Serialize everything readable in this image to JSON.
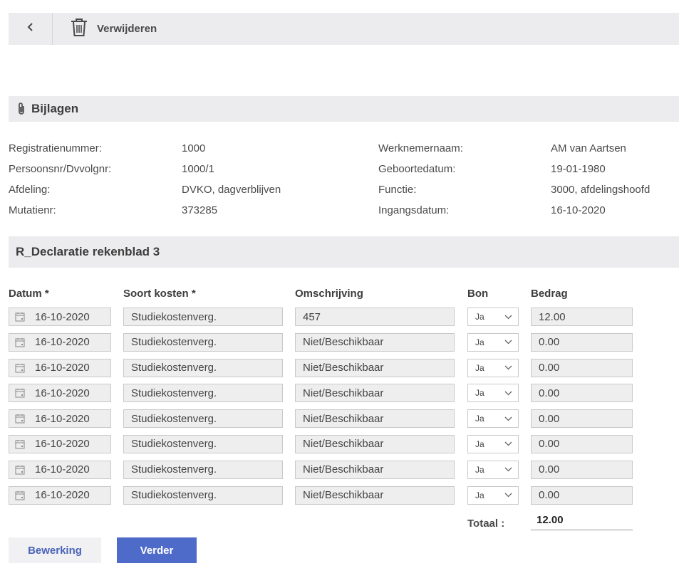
{
  "toolbar": {
    "delete_label": "Verwijderen",
    "back_icon": "chevron-left-icon",
    "delete_icon": "trash-icon"
  },
  "bijlagen": {
    "title": "Bijlagen",
    "icon": "paperclip-icon"
  },
  "info": {
    "left": [
      {
        "label": "Registratienummer:",
        "value": "1000"
      },
      {
        "label": "Persoonsnr/Dvvolgnr:",
        "value": "1000/1"
      },
      {
        "label": "Afdeling:",
        "value": "DVKO, dagverblijven"
      },
      {
        "label": "Mutatienr:",
        "value": "373285"
      }
    ],
    "right": [
      {
        "label": "Werknemernaam:",
        "value": "AM van Aartsen"
      },
      {
        "label": "Geboortedatum:",
        "value": "19-01-1980"
      },
      {
        "label": "Functie:",
        "value": "3000, afdelingshoofd"
      },
      {
        "label": "Ingangsdatum:",
        "value": "16-10-2020"
      }
    ]
  },
  "sheet": {
    "title": "R_Declaratie rekenblad 3",
    "columns": {
      "datum": "Datum *",
      "soort": "Soort kosten *",
      "omschrijving": "Omschrijving",
      "bon": "Bon",
      "bedrag": "Bedrag"
    },
    "rows": [
      {
        "datum": "16-10-2020",
        "soort": "Studiekostenverg.",
        "omschrijving": "457",
        "bon": "Ja",
        "bedrag": "12.00"
      },
      {
        "datum": "16-10-2020",
        "soort": "Studiekostenverg.",
        "omschrijving": "Niet/Beschikbaar",
        "bon": "Ja",
        "bedrag": "0.00"
      },
      {
        "datum": "16-10-2020",
        "soort": "Studiekostenverg.",
        "omschrijving": "Niet/Beschikbaar",
        "bon": "Ja",
        "bedrag": "0.00"
      },
      {
        "datum": "16-10-2020",
        "soort": "Studiekostenverg.",
        "omschrijving": "Niet/Beschikbaar",
        "bon": "Ja",
        "bedrag": "0.00"
      },
      {
        "datum": "16-10-2020",
        "soort": "Studiekostenverg.",
        "omschrijving": "Niet/Beschikbaar",
        "bon": "Ja",
        "bedrag": "0.00"
      },
      {
        "datum": "16-10-2020",
        "soort": "Studiekostenverg.",
        "omschrijving": "Niet/Beschikbaar",
        "bon": "Ja",
        "bedrag": "0.00"
      },
      {
        "datum": "16-10-2020",
        "soort": "Studiekostenverg.",
        "omschrijving": "Niet/Beschikbaar",
        "bon": "Ja",
        "bedrag": "0.00"
      },
      {
        "datum": "16-10-2020",
        "soort": "Studiekostenverg.",
        "omschrijving": "Niet/Beschikbaar",
        "bon": "Ja",
        "bedrag": "0.00"
      }
    ],
    "totaal_label": "Totaal :",
    "totaal_value": "12.00"
  },
  "buttons": {
    "bewerking": "Bewerking",
    "verder": "Verder"
  },
  "colors": {
    "header_bg": "#ececee",
    "field_bg": "#eeeeef",
    "primary": "#4e6bc9",
    "link": "#4a64b8"
  }
}
